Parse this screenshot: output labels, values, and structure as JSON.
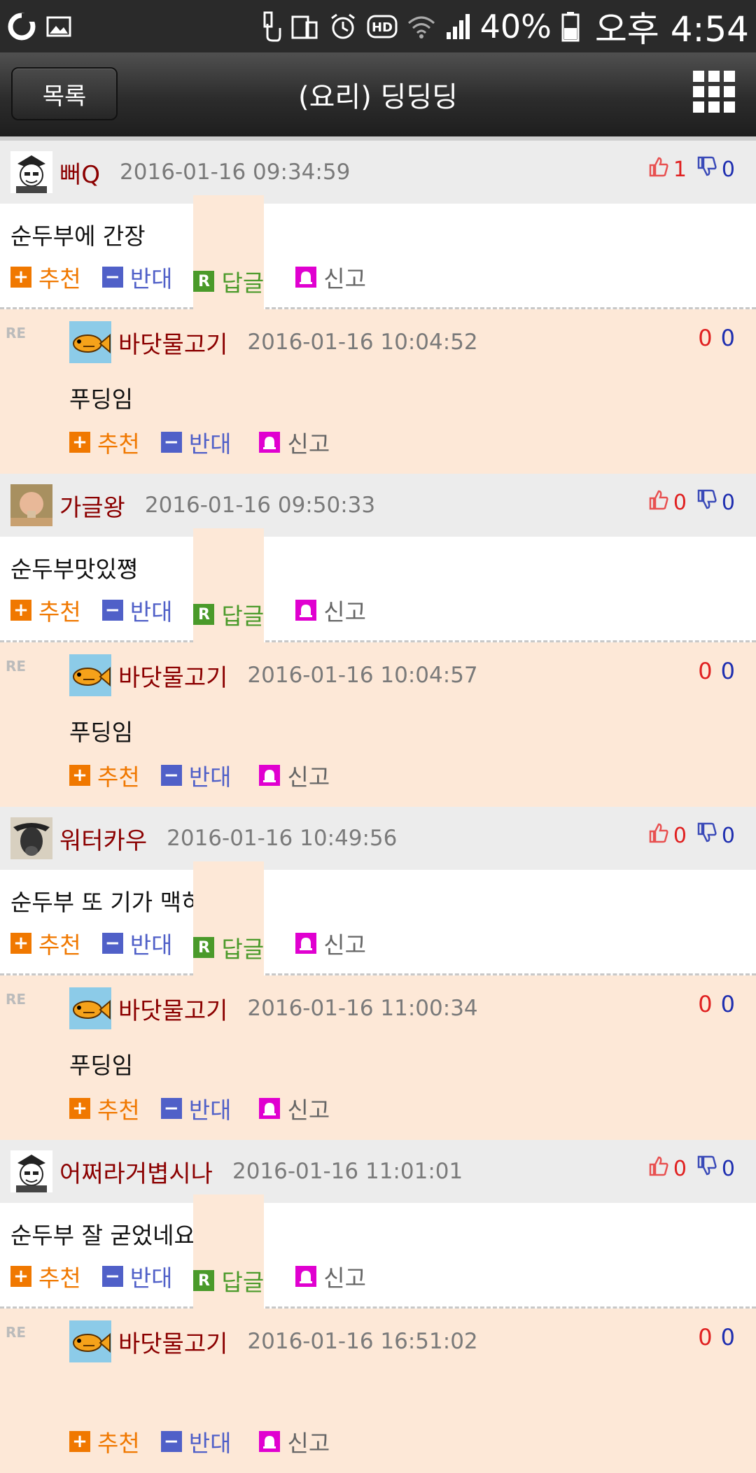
{
  "status_bar": {
    "battery": "40%",
    "time": "오후 4:54"
  },
  "header": {
    "back_label": "목록",
    "title": "(요리) 딩딩딩"
  },
  "actions": {
    "recommend": "추천",
    "oppose": "반대",
    "reply": "답글",
    "report": "신고"
  },
  "comments": [
    {
      "author": "뻐Q",
      "date": "2016-01-16 09:34:59",
      "up": "1",
      "down": "0",
      "text": "순두부에 간장",
      "reply": {
        "tag": "RE",
        "author": "바닷물고기",
        "date": "2016-01-16 10:04:52",
        "up": "0",
        "down": "0",
        "text": "푸딩임"
      }
    },
    {
      "author": "가글왕",
      "date": "2016-01-16 09:50:33",
      "up": "0",
      "down": "0",
      "text": "순두부맛있쪙",
      "reply": {
        "tag": "RE",
        "author": "바닷물고기",
        "date": "2016-01-16 10:04:57",
        "up": "0",
        "down": "0",
        "text": "푸딩임"
      }
    },
    {
      "author": "워터카우",
      "date": "2016-01-16 10:49:56",
      "up": "0",
      "down": "0",
      "text": "순두부 또 기가 맥히지",
      "reply": {
        "tag": "RE",
        "author": "바닷물고기",
        "date": "2016-01-16 11:00:34",
        "up": "0",
        "down": "0",
        "text": "푸딩임"
      }
    },
    {
      "author": "어쩌라거볍시나",
      "date": "2016-01-16 11:01:01",
      "up": "0",
      "down": "0",
      "text": "순두부 잘 굳었네요 ㅎㅎ",
      "reply": {
        "tag": "RE",
        "author": "바닷물고기",
        "date": "2016-01-16 16:51:02",
        "up": "0",
        "down": "0",
        "text": ""
      }
    }
  ]
}
